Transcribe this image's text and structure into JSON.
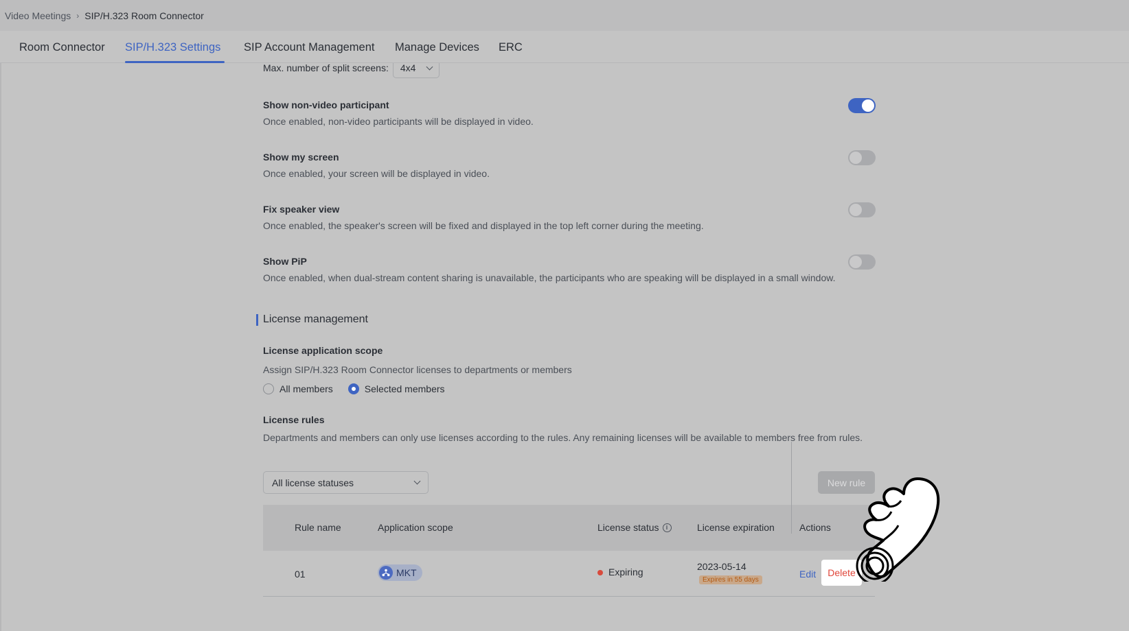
{
  "breadcrumb": {
    "parent": "Video Meetings",
    "separator": "›",
    "current": "SIP/H.323 Room Connector"
  },
  "tabs": [
    {
      "label": "Room Connector"
    },
    {
      "label": "SIP/H.323 Settings",
      "active": true
    },
    {
      "label": "SIP Account Management"
    },
    {
      "label": "Manage Devices"
    },
    {
      "label": "ERC"
    }
  ],
  "split_screens": {
    "label": "Max. number of split screens:",
    "value": "4x4"
  },
  "settings": [
    {
      "title": "Show non-video participant",
      "desc": "Once enabled, non-video participants will be displayed in video.",
      "enabled": true
    },
    {
      "title": "Show my screen",
      "desc": "Once enabled, your screen will be displayed in video.",
      "enabled": false
    },
    {
      "title": "Fix speaker view",
      "desc": "Once enabled, the speaker's screen will be fixed and displayed in the top left corner during the meeting.",
      "enabled": false
    },
    {
      "title": "Show PiP",
      "desc": "Once enabled, when dual-stream content sharing is unavailable, the participants who are speaking will be displayed in a small window.",
      "enabled": false
    }
  ],
  "license": {
    "section_title": "License management",
    "scope_title": "License application scope",
    "scope_desc": "Assign SIP/H.323 Room Connector licenses to departments or members",
    "options": [
      {
        "label": "All members",
        "checked": false
      },
      {
        "label": "Selected members",
        "checked": true
      }
    ],
    "rules_title": "License rules",
    "rules_desc": "Departments and members can only use licenses according to the rules. Any remaining licenses will be available to members free from rules.",
    "filter_value": "All license statuses",
    "new_rule_label": "New rule"
  },
  "table": {
    "headers": {
      "rule_name": "Rule name",
      "scope": "Application scope",
      "status": "License status",
      "expiration": "License expiration",
      "actions": "Actions"
    },
    "rows": [
      {
        "rule_name": "01",
        "scope_tag": "MKT",
        "status": "Expiring",
        "expiration": "2023-05-14",
        "expires_note": "Expires in 55 days",
        "edit_label": "Edit",
        "delete_label": "Delete"
      }
    ]
  },
  "colors": {
    "accent": "#3e64c2",
    "danger": "#e0463a",
    "warning": "#b35a12"
  }
}
